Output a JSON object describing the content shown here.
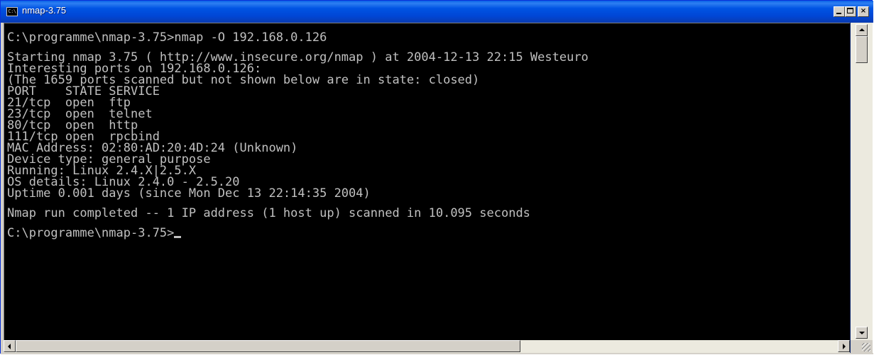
{
  "window": {
    "title": "nmap-3.75",
    "icon": "console-icon",
    "icon_text": "C:\\",
    "controls": {
      "minimize_icon": "minimize-icon",
      "maximize_icon": "maximize-icon",
      "close_label": "×"
    }
  },
  "colors": {
    "titlebar": "#0054e3",
    "console_bg": "#000000",
    "console_fg": "#c0c0c0"
  },
  "console": {
    "prompt_command": "C:\\programme\\nmap-3.75>nmap -O 192.168.0.126",
    "output": [
      "Starting nmap 3.75 ( http://www.insecure.org/nmap ) at 2004-12-13 22:15 Westeuro",
      "Interesting ports on 192.168.0.126:",
      "(The 1659 ports scanned but not shown below are in state: closed)",
      "PORT    STATE SERVICE",
      "21/tcp  open  ftp",
      "23/tcp  open  telnet",
      "80/tcp  open  http",
      "111/tcp open  rpcbind",
      "MAC Address: 02:80:AD:20:4D:24 (Unknown)",
      "Device type: general purpose",
      "Running: Linux 2.4.X|2.5.X",
      "OS details: Linux 2.4.0 - 2.5.20",
      "Uptime 0.001 days (since Mon Dec 13 22:14:35 2004)"
    ],
    "summary": "Nmap run completed -- 1 IP address (1 host up) scanned in 10.095 seconds",
    "final_prompt": "C:\\programme\\nmap-3.75>"
  }
}
